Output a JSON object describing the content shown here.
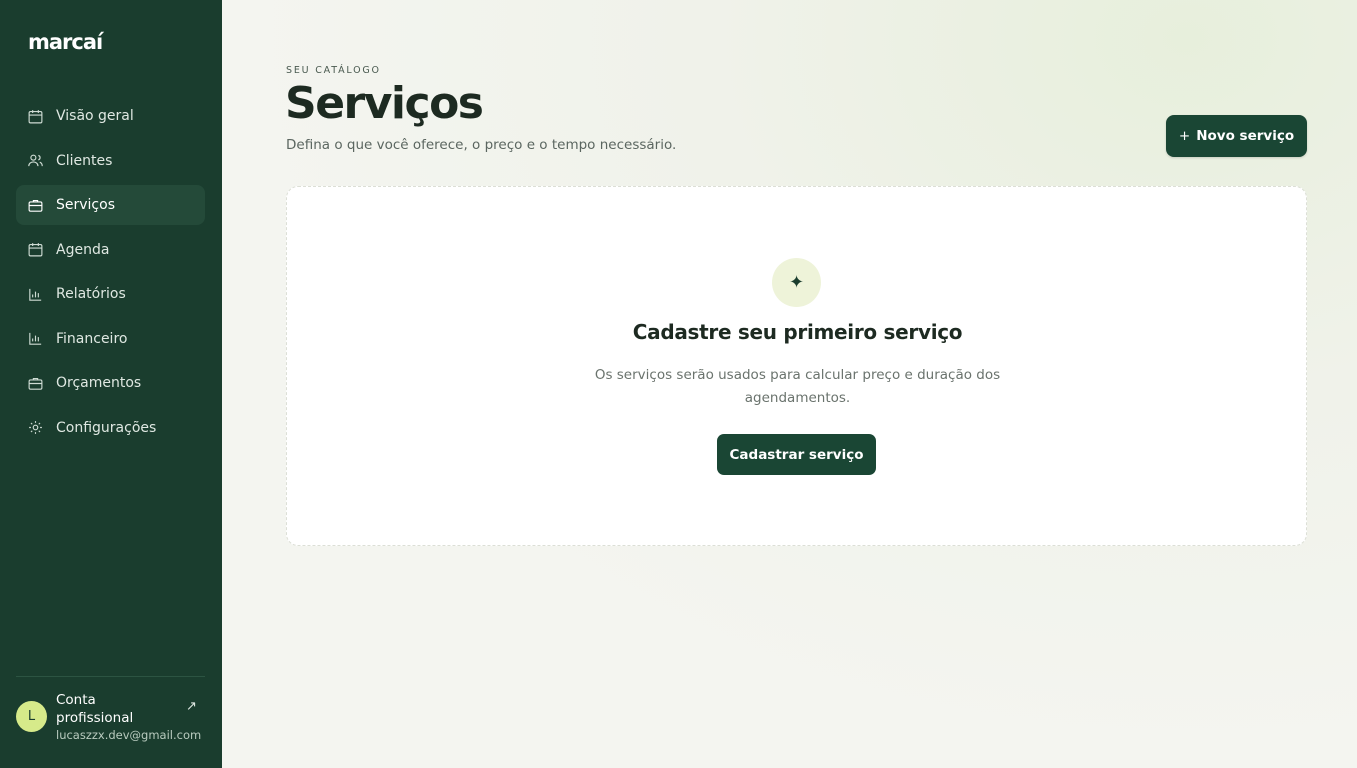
{
  "app": {
    "logo": "marcaí"
  },
  "sidebar": {
    "items": [
      {
        "label": "Visão geral",
        "icon": "calendar-icon"
      },
      {
        "label": "Clientes",
        "icon": "users-icon"
      },
      {
        "label": "Serviços",
        "icon": "briefcase-icon",
        "active": true
      },
      {
        "label": "Agenda",
        "icon": "calendar-icon"
      },
      {
        "label": "Relatórios",
        "icon": "bar-chart-icon"
      },
      {
        "label": "Financeiro",
        "icon": "bar-chart-icon"
      },
      {
        "label": "Orçamentos",
        "icon": "briefcase-icon"
      },
      {
        "label": "Configurações",
        "icon": "sun-gear-icon"
      }
    ],
    "account": {
      "avatar_initial": "L",
      "name": "Conta profissional",
      "email": "lucaszzx.dev@gmail.com",
      "arrow": "↗"
    }
  },
  "header": {
    "eyebrow": "SEU CATÁLOGO",
    "title": "Serviços",
    "subtitle": "Defina o que você oferece, o preço e o tempo necessário.",
    "new_button_plus": "+",
    "new_button_label": "Novo serviço"
  },
  "empty_state": {
    "icon_glyph": "✦",
    "title": "Cadastre seu primeiro serviço",
    "description": "Os serviços serão usados para calcular preço e duração dos agendamentos.",
    "button_label": "Cadastrar serviço"
  },
  "colors": {
    "sidebar_bg": "#1a3d2e",
    "active_item_bg": "#244a39",
    "primary_button": "#1a4634",
    "avatar_bg": "#d6ea8a"
  }
}
